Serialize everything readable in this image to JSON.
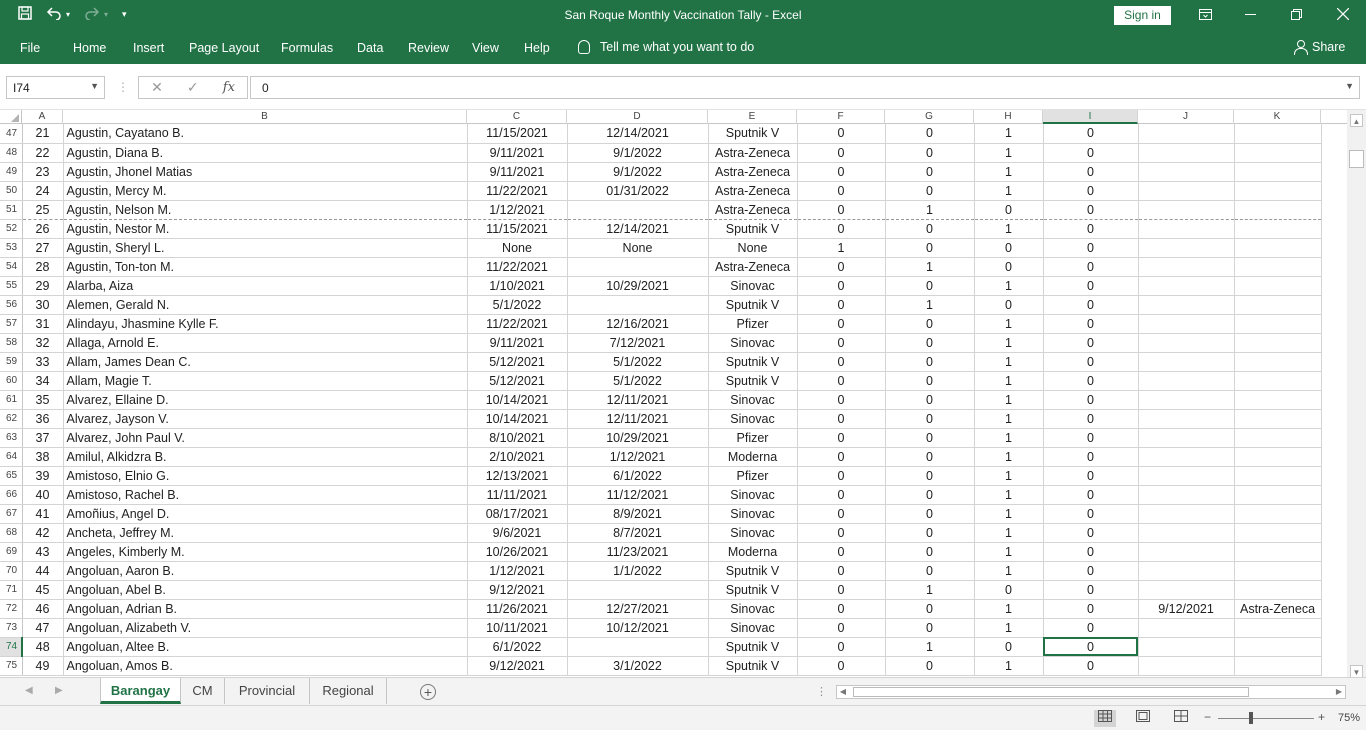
{
  "window": {
    "title": "San Roque Monthly Vaccination Tally  -  Excel",
    "sign_in": "Sign in"
  },
  "ribbon": {
    "tabs": [
      "File",
      "Home",
      "Insert",
      "Page Layout",
      "Formulas",
      "Data",
      "Review",
      "View",
      "Help"
    ],
    "tell_me": "Tell me what you want to do",
    "share": "Share"
  },
  "formula_bar": {
    "name_box": "I74",
    "cancel_icon": "✕",
    "enter_icon": "✓",
    "fx": "fx",
    "value": "0"
  },
  "columns": [
    "A",
    "B",
    "C",
    "D",
    "E",
    "F",
    "G",
    "H",
    "I",
    "J",
    "K"
  ],
  "selected_column": "I",
  "selected_row": "74",
  "rows": [
    {
      "r": "47",
      "a": "21",
      "b": "Agustin, Cayatano B.",
      "c": "11/15/2021",
      "d": "12/14/2021",
      "e": "Sputnik V",
      "f": "0",
      "g": "0",
      "h": "1",
      "i": "0",
      "j": "",
      "k": ""
    },
    {
      "r": "48",
      "a": "22",
      "b": "Agustin, Diana B.",
      "c": "9/11/2021",
      "d": "9/1/2022",
      "e": "Astra-Zeneca",
      "f": "0",
      "g": "0",
      "h": "1",
      "i": "0",
      "j": "",
      "k": ""
    },
    {
      "r": "49",
      "a": "23",
      "b": "Agustin, Jhonel Matias",
      "c": "9/11/2021",
      "d": "9/1/2022",
      "e": "Astra-Zeneca",
      "f": "0",
      "g": "0",
      "h": "1",
      "i": "0",
      "j": "",
      "k": ""
    },
    {
      "r": "50",
      "a": "24",
      "b": "Agustin, Mercy M.",
      "c": "11/22/2021",
      "d": "01/31/2022",
      "e": "Astra-Zeneca",
      "f": "0",
      "g": "0",
      "h": "1",
      "i": "0",
      "j": "",
      "k": ""
    },
    {
      "r": "51",
      "a": "25",
      "b": "Agustin, Nelson M.",
      "c": "1/12/2021",
      "d": "",
      "e": "Astra-Zeneca",
      "f": "0",
      "g": "1",
      "h": "0",
      "i": "0",
      "j": "",
      "k": ""
    },
    {
      "r": "52",
      "a": "26",
      "b": "Agustin, Nestor M.",
      "c": "11/15/2021",
      "d": "12/14/2021",
      "e": "Sputnik V",
      "f": "0",
      "g": "0",
      "h": "1",
      "i": "0",
      "j": "",
      "k": ""
    },
    {
      "r": "53",
      "a": "27",
      "b": "Agustin, Sheryl L.",
      "c": "None",
      "d": "None",
      "e": "None",
      "f": "1",
      "g": "0",
      "h": "0",
      "i": "0",
      "j": "",
      "k": ""
    },
    {
      "r": "54",
      "a": "28",
      "b": "Agustin, Ton-ton M.",
      "c": "11/22/2021",
      "d": "",
      "e": "Astra-Zeneca",
      "f": "0",
      "g": "1",
      "h": "0",
      "i": "0",
      "j": "",
      "k": ""
    },
    {
      "r": "55",
      "a": "29",
      "b": "Alarba, Aiza",
      "c": "1/10/2021",
      "d": "10/29/2021",
      "e": "Sinovac",
      "f": "0",
      "g": "0",
      "h": "1",
      "i": "0",
      "j": "",
      "k": ""
    },
    {
      "r": "56",
      "a": "30",
      "b": "Alemen, Gerald N.",
      "c": "5/1/2022",
      "d": "",
      "e": "Sputnik V",
      "f": "0",
      "g": "1",
      "h": "0",
      "i": "0",
      "j": "",
      "k": ""
    },
    {
      "r": "57",
      "a": "31",
      "b": "Alindayu, Jhasmine Kylle F.",
      "c": "11/22/2021",
      "d": "12/16/2021",
      "e": "Pfizer",
      "f": "0",
      "g": "0",
      "h": "1",
      "i": "0",
      "j": "",
      "k": ""
    },
    {
      "r": "58",
      "a": "32",
      "b": "Allaga, Arnold E.",
      "c": "9/11/2021",
      "d": "7/12/2021",
      "e": "Sinovac",
      "f": "0",
      "g": "0",
      "h": "1",
      "i": "0",
      "j": "",
      "k": ""
    },
    {
      "r": "59",
      "a": "33",
      "b": "Allam, James Dean C.",
      "c": "5/12/2021",
      "d": "5/1/2022",
      "e": "Sputnik V",
      "f": "0",
      "g": "0",
      "h": "1",
      "i": "0",
      "j": "",
      "k": ""
    },
    {
      "r": "60",
      "a": "34",
      "b": "Allam, Magie T.",
      "c": "5/12/2021",
      "d": "5/1/2022",
      "e": "Sputnik V",
      "f": "0",
      "g": "0",
      "h": "1",
      "i": "0",
      "j": "",
      "k": ""
    },
    {
      "r": "61",
      "a": "35",
      "b": "Alvarez, Ellaine D.",
      "c": "10/14/2021",
      "d": "12/11/2021",
      "e": "Sinovac",
      "f": "0",
      "g": "0",
      "h": "1",
      "i": "0",
      "j": "",
      "k": ""
    },
    {
      "r": "62",
      "a": "36",
      "b": "Alvarez, Jayson V.",
      "c": "10/14/2021",
      "d": "12/11/2021",
      "e": "Sinovac",
      "f": "0",
      "g": "0",
      "h": "1",
      "i": "0",
      "j": "",
      "k": ""
    },
    {
      "r": "63",
      "a": "37",
      "b": "Alvarez, John Paul V.",
      "c": "8/10/2021",
      "d": "10/29/2021",
      "e": "Pfizer",
      "f": "0",
      "g": "0",
      "h": "1",
      "i": "0",
      "j": "",
      "k": ""
    },
    {
      "r": "64",
      "a": "38",
      "b": "Amilul, Alkidzra B.",
      "c": "2/10/2021",
      "d": "1/12/2021",
      "e": "Moderna",
      "f": "0",
      "g": "0",
      "h": "1",
      "i": "0",
      "j": "",
      "k": ""
    },
    {
      "r": "65",
      "a": "39",
      "b": "Amistoso, Elnio G.",
      "c": "12/13/2021",
      "d": "6/1/2022",
      "e": "Pfizer",
      "f": "0",
      "g": "0",
      "h": "1",
      "i": "0",
      "j": "",
      "k": ""
    },
    {
      "r": "66",
      "a": "40",
      "b": "Amistoso, Rachel B.",
      "c": "11/11/2021",
      "d": "11/12/2021",
      "e": "Sinovac",
      "f": "0",
      "g": "0",
      "h": "1",
      "i": "0",
      "j": "",
      "k": ""
    },
    {
      "r": "67",
      "a": "41",
      "b": "Amoñius, Angel D.",
      "c": "08/17/2021",
      "d": "8/9/2021",
      "e": "Sinovac",
      "f": "0",
      "g": "0",
      "h": "1",
      "i": "0",
      "j": "",
      "k": ""
    },
    {
      "r": "68",
      "a": "42",
      "b": "Ancheta, Jeffrey M.",
      "c": "9/6/2021",
      "d": "8/7/2021",
      "e": "Sinovac",
      "f": "0",
      "g": "0",
      "h": "1",
      "i": "0",
      "j": "",
      "k": ""
    },
    {
      "r": "69",
      "a": "43",
      "b": "Angeles, Kimberly M.",
      "c": "10/26/2021",
      "d": "11/23/2021",
      "e": "Moderna",
      "f": "0",
      "g": "0",
      "h": "1",
      "i": "0",
      "j": "",
      "k": ""
    },
    {
      "r": "70",
      "a": "44",
      "b": "Angoluan, Aaron B.",
      "c": "1/12/2021",
      "d": "1/1/2022",
      "e": "Sputnik V",
      "f": "0",
      "g": "0",
      "h": "1",
      "i": "0",
      "j": "",
      "k": ""
    },
    {
      "r": "71",
      "a": "45",
      "b": "Angoluan, Abel B.",
      "c": "9/12/2021",
      "d": "",
      "e": "Sputnik V",
      "f": "0",
      "g": "1",
      "h": "0",
      "i": "0",
      "j": "",
      "k": ""
    },
    {
      "r": "72",
      "a": "46",
      "b": "Angoluan, Adrian B.",
      "c": "11/26/2021",
      "d": "12/27/2021",
      "e": "Sinovac",
      "f": "0",
      "g": "0",
      "h": "1",
      "i": "0",
      "j": "9/12/2021",
      "k": "Astra-Zeneca"
    },
    {
      "r": "73",
      "a": "47",
      "b": "Angoluan, Alizabeth V.",
      "c": "10/11/2021",
      "d": "10/12/2021",
      "e": "Sinovac",
      "f": "0",
      "g": "0",
      "h": "1",
      "i": "0",
      "j": "",
      "k": ""
    },
    {
      "r": "74",
      "a": "48",
      "b": "Angoluan, Altee B.",
      "c": "6/1/2022",
      "d": "",
      "e": "Sputnik V",
      "f": "0",
      "g": "1",
      "h": "0",
      "i": "0",
      "j": "",
      "k": ""
    },
    {
      "r": "75",
      "a": "49",
      "b": "Angoluan, Amos B.",
      "c": "9/12/2021",
      "d": "3/1/2022",
      "e": "Sputnik V",
      "f": "0",
      "g": "0",
      "h": "1",
      "i": "0",
      "j": "",
      "k": ""
    }
  ],
  "sheets": [
    "Barangay",
    "CM",
    "Provincial",
    "Regional"
  ],
  "active_sheet": "Barangay",
  "status": {
    "zoom": "75%"
  },
  "colors": {
    "accent": "#217346"
  }
}
